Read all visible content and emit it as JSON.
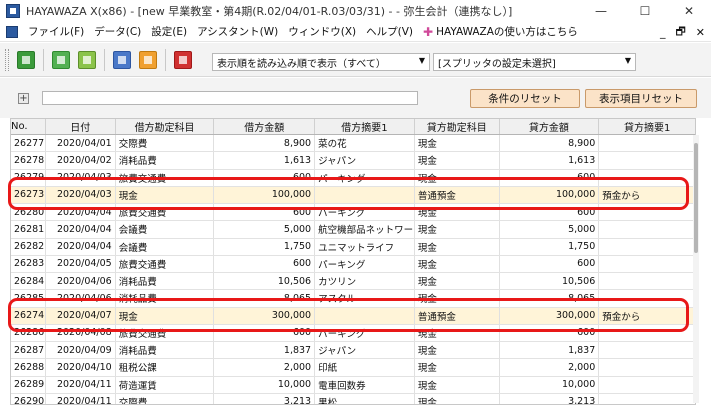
{
  "window": {
    "title": "HAYAWAZA X(x86) - [new 早業教室・第4期(R.02/04/01-R.03/03/31) - - 弥生会計（連携なし）]",
    "minimize": "—",
    "maximize": "☐",
    "close": "✕"
  },
  "menu": {
    "items": [
      "ファイル(F)",
      "データ(C)",
      "設定(E)",
      "アシスタント(W)",
      "ウィンドウ(X)",
      "ヘルプ(V)"
    ],
    "help_link": "HAYAWAZAの使い方はこちら",
    "mdi_min": "_",
    "mdi_restore": "🗗",
    "mdi_close": "✕"
  },
  "toolbar": {
    "order_combo": "表示順を読み込み順で表示（すべて）",
    "splitter_combo": "[スプリッタの設定未選択]",
    "combo_arrow": "▼"
  },
  "filter": {
    "plus": "+",
    "reset_conditions": "条件のリセット",
    "reset_display": "表示項目リセット"
  },
  "grid": {
    "columns": [
      "No.",
      "日付",
      "借方勘定科目",
      "借方金額",
      "借方摘要1",
      "貸方勘定科目",
      "貸方金額",
      "貸方摘要1"
    ],
    "rows": [
      {
        "no": "26277",
        "date": "2020/04/01",
        "dacct": "交際費",
        "damt": "8,900",
        "dmemo": "菜の花",
        "cacct": "現金",
        "camt": "8,900",
        "cmemo": "",
        "hl": false
      },
      {
        "no": "26278",
        "date": "2020/04/02",
        "dacct": "消耗品費",
        "damt": "1,613",
        "dmemo": "ジャパン",
        "cacct": "現金",
        "camt": "1,613",
        "cmemo": "",
        "hl": false
      },
      {
        "no": "26279",
        "date": "2020/04/03",
        "dacct": "旅費交通費",
        "damt": "600",
        "dmemo": "パーキング",
        "cacct": "現金",
        "camt": "600",
        "cmemo": "",
        "hl": false
      },
      {
        "no": "26273",
        "date": "2020/04/03",
        "dacct": "現金",
        "damt": "100,000",
        "dmemo": "",
        "cacct": "普通預金",
        "camt": "100,000",
        "cmemo": "預金から",
        "hl": true
      },
      {
        "no": "26280",
        "date": "2020/04/04",
        "dacct": "旅費交通費",
        "damt": "600",
        "dmemo": "パーキング",
        "cacct": "現金",
        "camt": "600",
        "cmemo": "",
        "hl": false
      },
      {
        "no": "26281",
        "date": "2020/04/04",
        "dacct": "会議費",
        "damt": "5,000",
        "dmemo": "航空機部品ネットワー…",
        "cacct": "現金",
        "camt": "5,000",
        "cmemo": "",
        "hl": false
      },
      {
        "no": "26282",
        "date": "2020/04/04",
        "dacct": "会議費",
        "damt": "1,750",
        "dmemo": "ユニマットライフ",
        "cacct": "現金",
        "camt": "1,750",
        "cmemo": "",
        "hl": false
      },
      {
        "no": "26283",
        "date": "2020/04/05",
        "dacct": "旅費交通費",
        "damt": "600",
        "dmemo": "パーキング",
        "cacct": "現金",
        "camt": "600",
        "cmemo": "",
        "hl": false
      },
      {
        "no": "26284",
        "date": "2020/04/06",
        "dacct": "消耗品費",
        "damt": "10,506",
        "dmemo": "カツリン",
        "cacct": "現金",
        "camt": "10,506",
        "cmemo": "",
        "hl": false
      },
      {
        "no": "26285",
        "date": "2020/04/06",
        "dacct": "消耗品費",
        "damt": "8,065",
        "dmemo": "アスクル",
        "cacct": "現金",
        "camt": "8,065",
        "cmemo": "",
        "hl": false
      },
      {
        "no": "26274",
        "date": "2020/04/07",
        "dacct": "現金",
        "damt": "300,000",
        "dmemo": "",
        "cacct": "普通預金",
        "camt": "300,000",
        "cmemo": "預金から",
        "hl": true
      },
      {
        "no": "26286",
        "date": "2020/04/08",
        "dacct": "旅費交通費",
        "damt": "600",
        "dmemo": "パーキング",
        "cacct": "現金",
        "camt": "600",
        "cmemo": "",
        "hl": false
      },
      {
        "no": "26287",
        "date": "2020/04/09",
        "dacct": "消耗品費",
        "damt": "1,837",
        "dmemo": "ジャパン",
        "cacct": "現金",
        "camt": "1,837",
        "cmemo": "",
        "hl": false
      },
      {
        "no": "26288",
        "date": "2020/04/10",
        "dacct": "租税公課",
        "damt": "2,000",
        "dmemo": "印紙",
        "cacct": "現金",
        "camt": "2,000",
        "cmemo": "",
        "hl": false
      },
      {
        "no": "26289",
        "date": "2020/04/11",
        "dacct": "荷造運賃",
        "damt": "10,000",
        "dmemo": "電車回数券",
        "cacct": "現金",
        "camt": "10,000",
        "cmemo": "",
        "hl": false
      },
      {
        "no": "26290",
        "date": "2020/04/11",
        "dacct": "交際費",
        "damt": "3,213",
        "dmemo": "果松",
        "cacct": "現金",
        "camt": "3,213",
        "cmemo": "",
        "hl": false
      }
    ]
  },
  "colors": {
    "annotation": "#e81818",
    "highlight_row": "#fff4d8",
    "action_button": "#fbe3c8"
  }
}
